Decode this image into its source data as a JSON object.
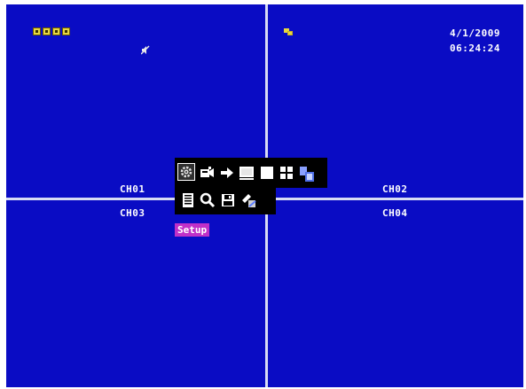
{
  "channels": {
    "ch1": "CH01",
    "ch2": "CH02",
    "ch3": "CH03",
    "ch4": "CH04"
  },
  "status": {
    "date": "4/1/2009",
    "time": "06:24:24",
    "hdd_icons": [
      "hdd-icon",
      "hdd-icon",
      "hdd-icon",
      "hdd-icon"
    ],
    "audio_icon": "audio-mute-icon",
    "network_icon": "network-icon"
  },
  "menu": {
    "row1_icons": [
      "setup-gear-icon",
      "ptz-camera-icon",
      "arrow-right-icon",
      "monitor-icon",
      "single-screen-icon",
      "quad-screen-icon",
      "sequence-icon"
    ],
    "row2_icons": [
      "event-log-icon",
      "search-icon",
      "backup-disk-icon",
      "key-lock-icon"
    ],
    "selected_label": "Setup"
  },
  "colors": {
    "screen_bg": "#0a0cc4",
    "divider": "#d8dcf4",
    "tooltip_bg": "#c030c8",
    "hdd_yellow": "#e8d840"
  }
}
